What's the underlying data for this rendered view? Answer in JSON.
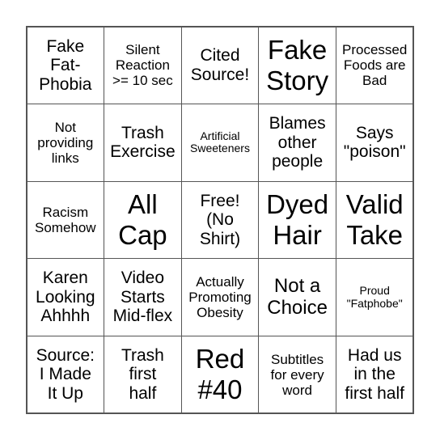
{
  "board": {
    "size": 5,
    "cells": [
      {
        "text": "Fake\nFat-\nPhobia",
        "size": "s-md"
      },
      {
        "text": "Silent\nReaction\n>= 10 sec",
        "size": "s-sm"
      },
      {
        "text": "Cited\nSource!",
        "size": "s-md"
      },
      {
        "text": "Fake\nStory",
        "size": "s-xl"
      },
      {
        "text": "Processed\nFoods are\nBad",
        "size": "s-sm"
      },
      {
        "text": "Not\nproviding\nlinks",
        "size": "s-sm"
      },
      {
        "text": "Trash\nExercise",
        "size": "s-md"
      },
      {
        "text": "Artificial\nSweeteners",
        "size": "s-xs"
      },
      {
        "text": "Blames\nother\npeople",
        "size": "s-md"
      },
      {
        "text": "Says\n\"poison\"",
        "size": "s-md"
      },
      {
        "text": "Racism\nSomehow",
        "size": "s-sm"
      },
      {
        "text": "All\nCap",
        "size": "s-xl"
      },
      {
        "text": "Free!\n(No\nShirt)",
        "size": "s-md"
      },
      {
        "text": "Dyed\nHair",
        "size": "s-xl"
      },
      {
        "text": "Valid\nTake",
        "size": "s-xl"
      },
      {
        "text": "Karen\nLooking\nAhhhh",
        "size": "s-md"
      },
      {
        "text": "Video\nStarts\nMid-flex",
        "size": "s-md"
      },
      {
        "text": "Actually\nPromoting\nObesity",
        "size": "s-sm"
      },
      {
        "text": "Not a\nChoice",
        "size": "s-lg"
      },
      {
        "text": "Proud\n\"Fatphobe\"",
        "size": "s-xs"
      },
      {
        "text": "Source:\nI Made\nIt Up",
        "size": "s-md"
      },
      {
        "text": "Trash\nfirst\nhalf",
        "size": "s-md"
      },
      {
        "text": "Red\n#40",
        "size": "s-xl"
      },
      {
        "text": "Subtitles\nfor every\nword",
        "size": "s-sm"
      },
      {
        "text": "Had us\nin the\nfirst half",
        "size": "s-md"
      }
    ]
  }
}
